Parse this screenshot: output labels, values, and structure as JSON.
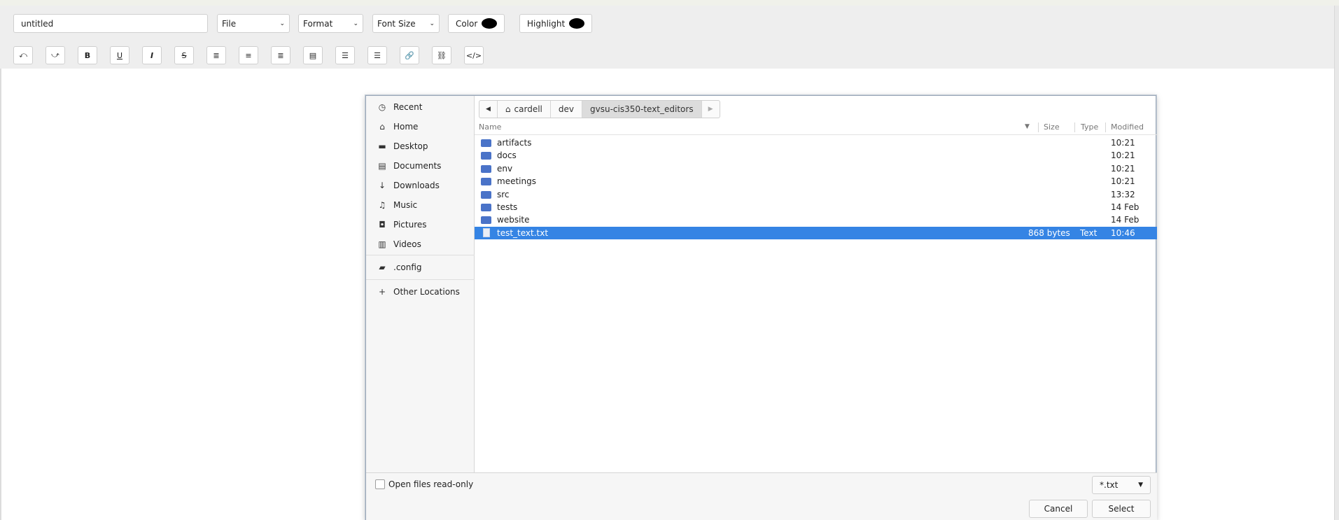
{
  "editor": {
    "title_value": "untitled",
    "menus": {
      "file": "File",
      "format": "Format",
      "font_size": "Font Size"
    },
    "color_label": "Color",
    "highlight_label": "Highlight",
    "format_buttons": [
      {
        "name": "undo",
        "glyph": "⤺"
      },
      {
        "name": "redo",
        "glyph": "⤻"
      },
      {
        "name": "bold",
        "glyph": "B"
      },
      {
        "name": "underline",
        "glyph": "U"
      },
      {
        "name": "italic",
        "glyph": "I"
      },
      {
        "name": "strikethrough",
        "glyph": "S"
      },
      {
        "name": "align-left",
        "glyph": "≣"
      },
      {
        "name": "align-center",
        "glyph": "≡"
      },
      {
        "name": "align-right",
        "glyph": "≣"
      },
      {
        "name": "justify",
        "glyph": "▤"
      },
      {
        "name": "bullet-list",
        "glyph": "☰"
      },
      {
        "name": "numbered-list",
        "glyph": "☰"
      },
      {
        "name": "link",
        "glyph": "🔗"
      },
      {
        "name": "unlink",
        "glyph": "⛓"
      },
      {
        "name": "code",
        "glyph": "</>"
      }
    ]
  },
  "dialog": {
    "places": [
      {
        "label": "Recent",
        "icon": "clock-icon"
      },
      {
        "label": "Home",
        "icon": "home-icon"
      },
      {
        "label": "Desktop",
        "icon": "desktop-icon"
      },
      {
        "label": "Documents",
        "icon": "documents-icon"
      },
      {
        "label": "Downloads",
        "icon": "download-icon"
      },
      {
        "label": "Music",
        "icon": "music-icon"
      },
      {
        "label": "Pictures",
        "icon": "camera-icon"
      },
      {
        "label": "Videos",
        "icon": "film-icon"
      }
    ],
    "bookmarks": [
      {
        "label": ".config",
        "icon": "folder-icon"
      }
    ],
    "other_locations": {
      "label": "Other Locations",
      "icon": "plus-icon"
    },
    "path": [
      "cardell",
      "dev",
      "gvsu-cis350-text_editors"
    ],
    "columns": {
      "name": "Name",
      "size": "Size",
      "type": "Type",
      "modified": "Modified"
    },
    "files": [
      {
        "name": "artifacts",
        "kind": "folder",
        "size": "",
        "type": "",
        "modified": "10:21"
      },
      {
        "name": "docs",
        "kind": "folder",
        "size": "",
        "type": "",
        "modified": "10:21"
      },
      {
        "name": "env",
        "kind": "folder",
        "size": "",
        "type": "",
        "modified": "10:21"
      },
      {
        "name": "meetings",
        "kind": "folder",
        "size": "",
        "type": "",
        "modified": "10:21"
      },
      {
        "name": "src",
        "kind": "folder",
        "size": "",
        "type": "",
        "modified": "13:32"
      },
      {
        "name": "tests",
        "kind": "folder",
        "size": "",
        "type": "",
        "modified": "14 Feb"
      },
      {
        "name": "website",
        "kind": "folder",
        "size": "",
        "type": "",
        "modified": "14 Feb"
      },
      {
        "name": "test_text.txt",
        "kind": "file",
        "size": "868 bytes",
        "type": "Text",
        "modified": "10:46",
        "selected": true
      }
    ],
    "read_only_label": "Open files read-only",
    "filter": "*.txt",
    "cancel_label": "Cancel",
    "select_label": "Select",
    "colors": {
      "selection": "#3584e4",
      "folder": "#4a73c8"
    }
  }
}
